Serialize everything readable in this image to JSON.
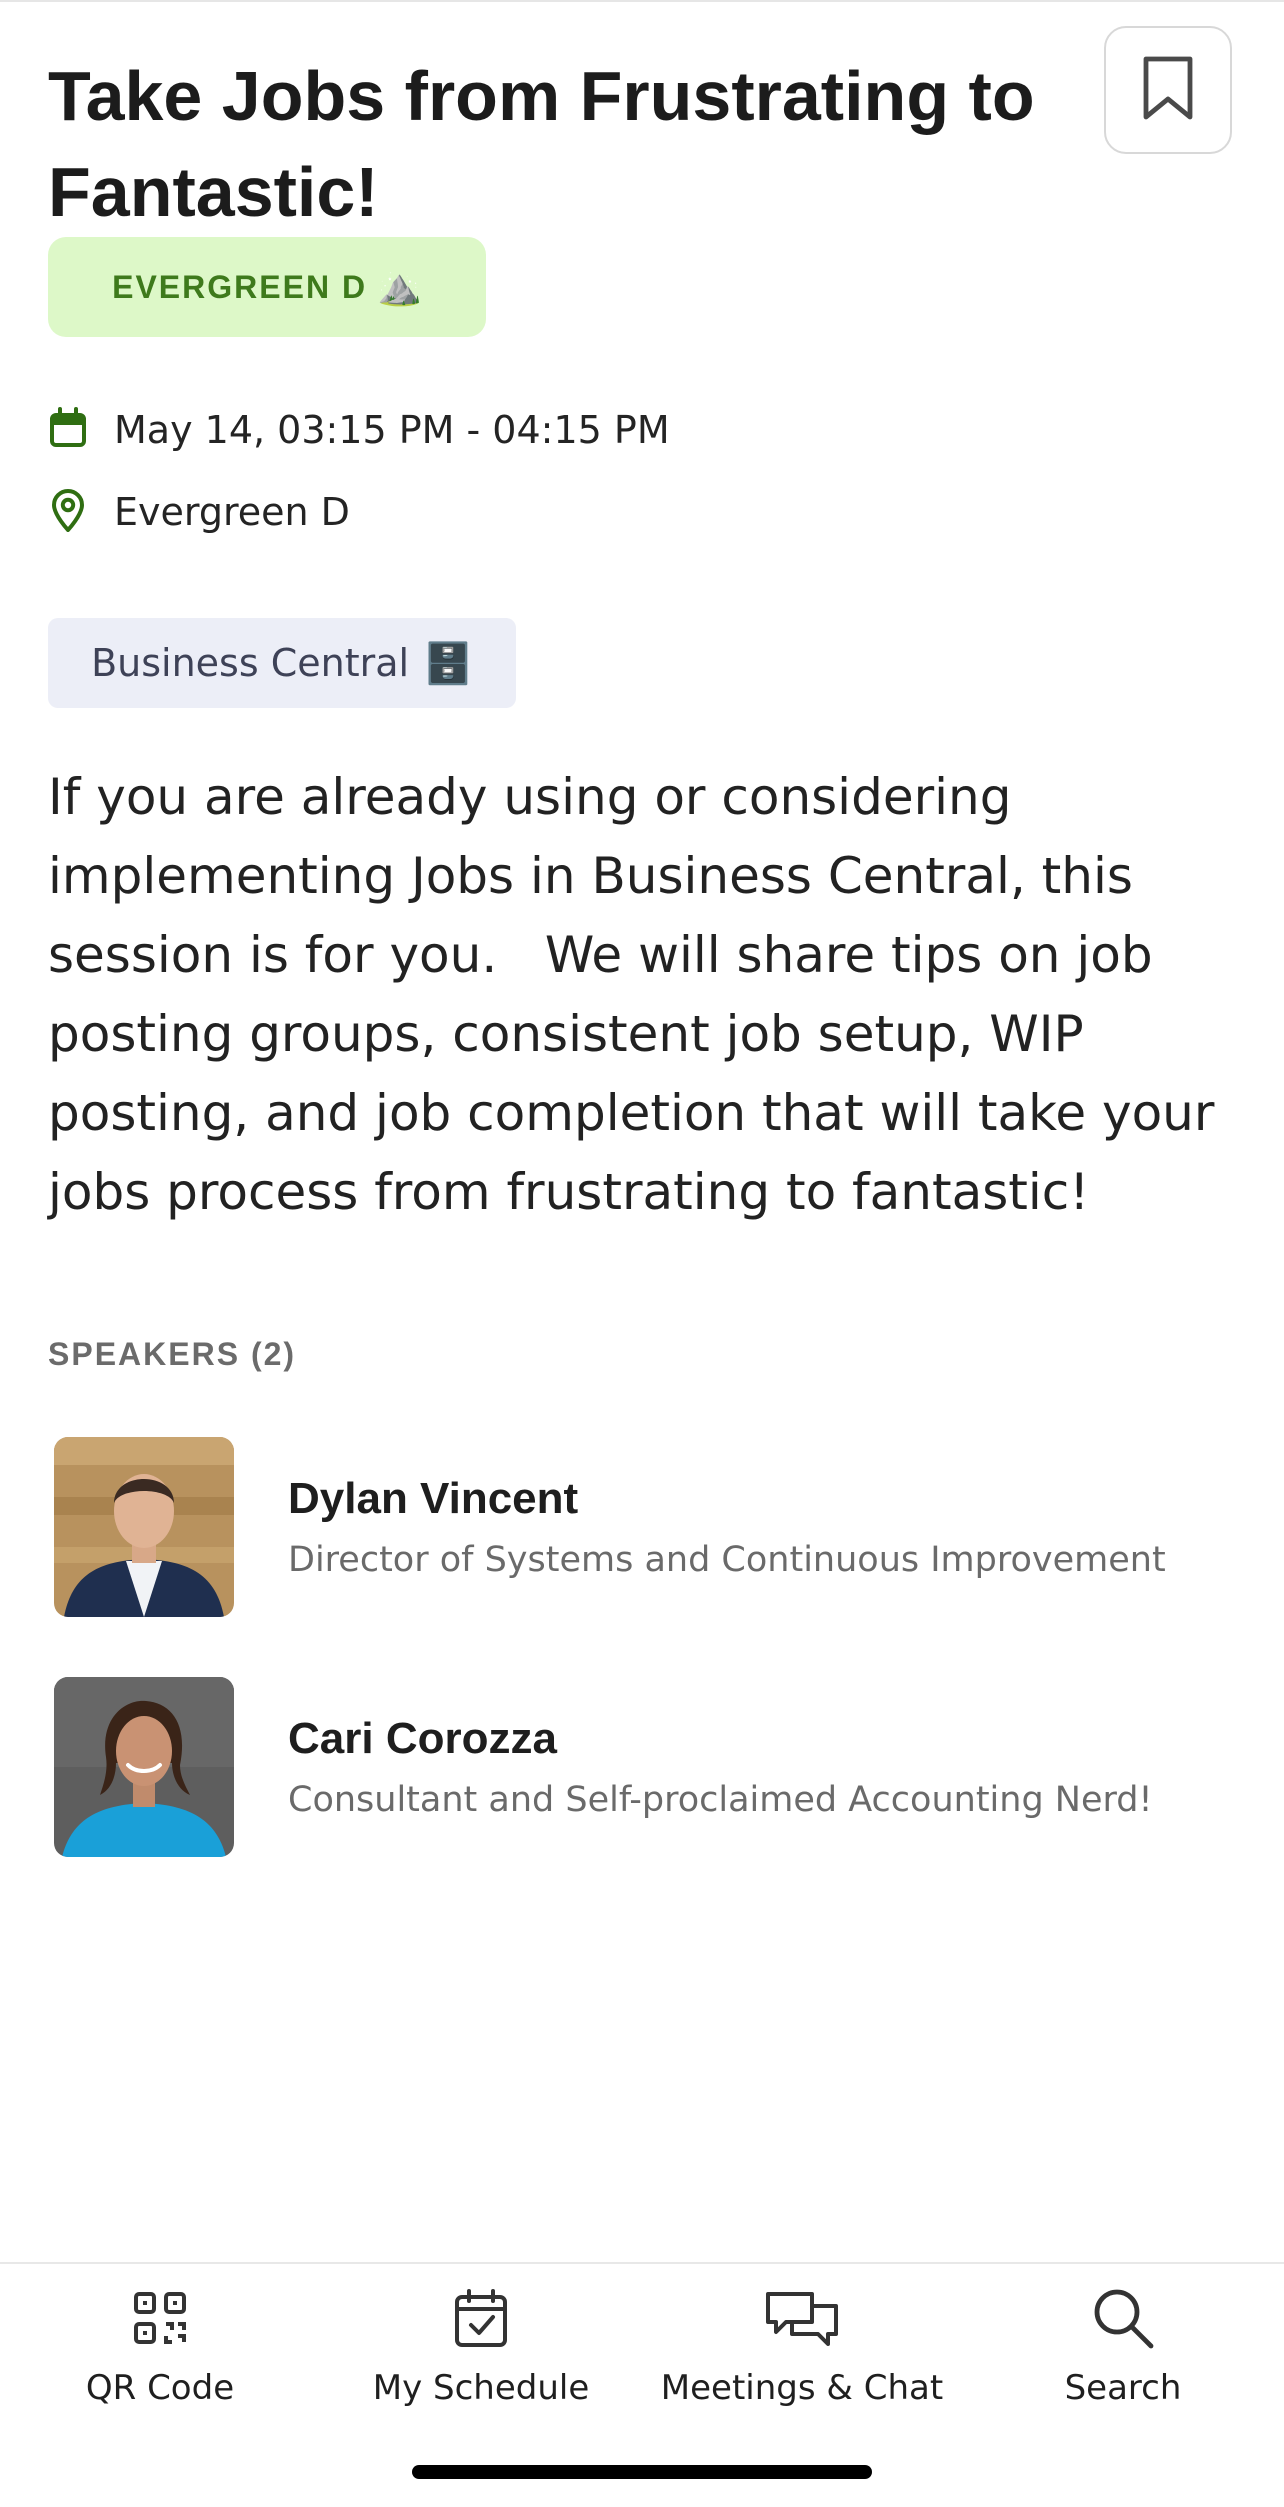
{
  "session": {
    "title": "Take Jobs from Frustrating to Fantastic!",
    "room_badge": "EVERGREEN D",
    "room_badge_emoji": "⛰️",
    "datetime": "May 14, 03:15 PM - 04:15 PM",
    "location": "Evergreen D",
    "track": "Business Central",
    "track_emoji": "🗄️",
    "description": "If you are already using or considering implementing Jobs in Business Central, this session is for you.   We will share tips on job posting groups, consistent job setup, WIP posting, and job completion that will take your jobs process from frustrating to fantastic!"
  },
  "speakers": {
    "heading": "SPEAKERS (2)",
    "list": [
      {
        "name": "Dylan Vincent",
        "title": "Director of Systems and Continuous Improvement"
      },
      {
        "name": "Cari Corozza",
        "title": "Consultant and Self-proclaimed Accounting Nerd!"
      }
    ]
  },
  "tabbar": {
    "items": [
      {
        "label": "QR Code",
        "icon": "qr-code-icon"
      },
      {
        "label": "My Schedule",
        "icon": "calendar-check-icon"
      },
      {
        "label": "Meetings & Chat",
        "icon": "chat-bubbles-icon"
      },
      {
        "label": "Search",
        "icon": "search-icon"
      }
    ]
  },
  "colors": {
    "accent_green": "#2f6e12",
    "badge_bg": "#ddf8c8",
    "badge_text": "#3e7a1c",
    "tag_bg": "#eceef7"
  }
}
